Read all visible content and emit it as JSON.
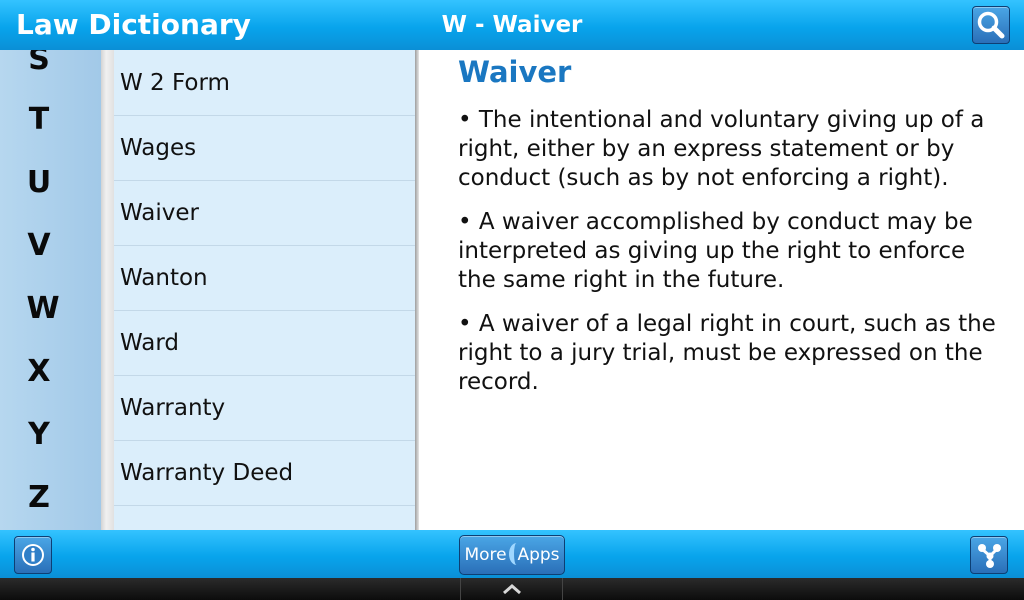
{
  "header": {
    "app_title": "Law Dictionary",
    "page_title": "W - Waiver"
  },
  "alphabet": [
    "S",
    "T",
    "U",
    "V",
    "W",
    "X",
    "Y",
    "Z"
  ],
  "terms": [
    "W 2 Form",
    "Wages",
    "Waiver",
    "Wanton",
    "Ward",
    "Warranty",
    "Warranty Deed"
  ],
  "entry": {
    "heading": "Waiver",
    "definitions": [
      "• The intentional and voluntary giving up of a right, either by an express statement or by conduct (such as by not enforcing a right).",
      "• A waiver accomplished by conduct may be interpreted as giving up the right to enforce the same right in the future.",
      "• A waiver of a legal right in court, such as the right to a jury trial, must be expressed on the record."
    ]
  },
  "footer": {
    "more_label": "More",
    "apps_label": "Apps"
  },
  "colors": {
    "bar_blue": "#08a4ec",
    "heading_blue": "#1a77c1",
    "list_bg": "#dbeefb",
    "alpha_bg": "#a2c9e8"
  },
  "icons": {
    "search": "magnifier",
    "info": "info-i",
    "share": "share-nodes",
    "nav": "chevron-up"
  }
}
